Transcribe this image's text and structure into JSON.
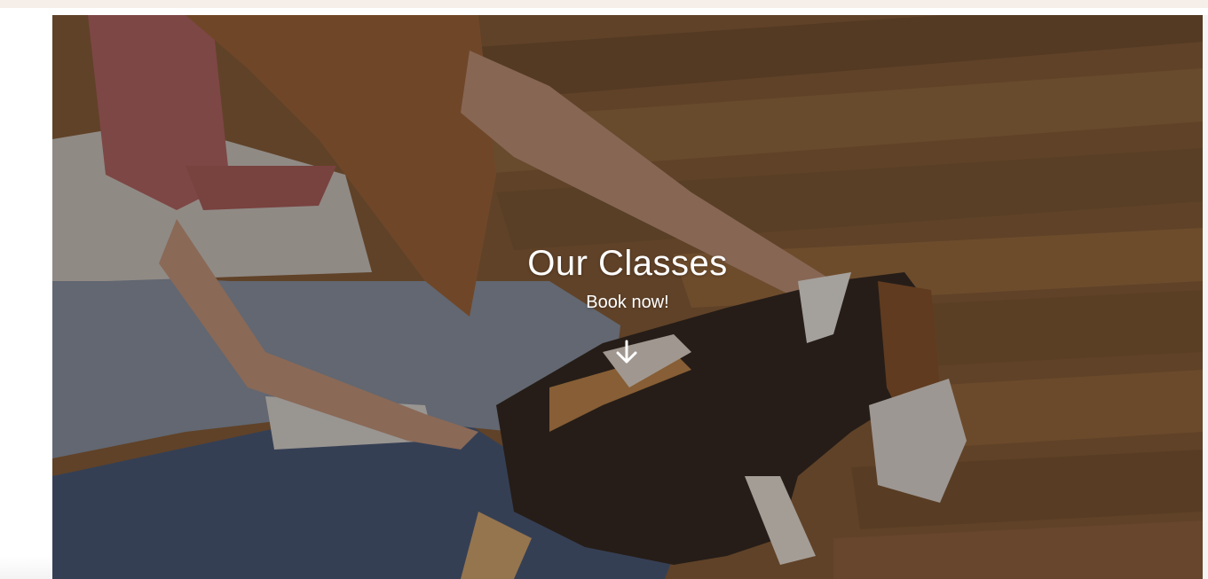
{
  "hero": {
    "title": "Our Classes",
    "subtitle": "Book now!",
    "scroll_icon": "arrow-down-icon",
    "photo_subject": "",
    "overlay_color": "#1e1610"
  },
  "colors": {
    "top_strip": "#f6eee8",
    "text": "#ffffff"
  }
}
